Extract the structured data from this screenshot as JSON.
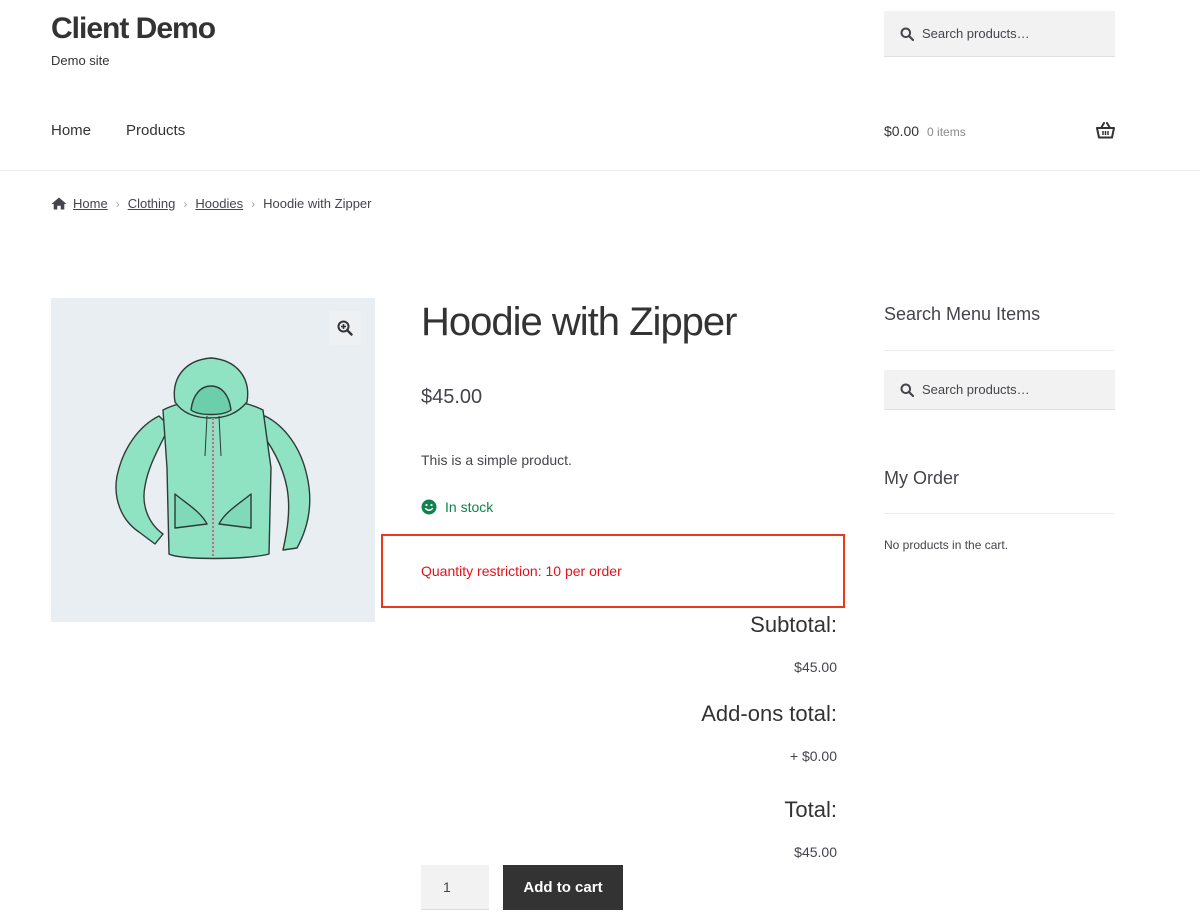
{
  "site": {
    "title": "Client Demo",
    "description": "Demo site"
  },
  "search": {
    "placeholder": "Search products…"
  },
  "nav": {
    "items": [
      "Home",
      "Products"
    ]
  },
  "cart": {
    "amount": "$0.00",
    "count": "0 items"
  },
  "breadcrumb": {
    "items": [
      "Home",
      "Clothing",
      "Hoodies",
      "Hoodie with Zipper"
    ]
  },
  "product": {
    "title": "Hoodie with Zipper",
    "price": "$45.00",
    "description": "This is a simple product.",
    "stock": "In stock",
    "restriction": "Quantity restriction: 10 per order",
    "quantity": "1",
    "add_to_cart": "Add to cart"
  },
  "totals": {
    "subtotal_label": "Subtotal:",
    "subtotal_value": "$45.00",
    "addons_label": "Add-ons total:",
    "addons_value": "+ $0.00",
    "total_label": "Total:",
    "total_value": "$45.00"
  },
  "sidebar": {
    "search_title": "Search Menu Items",
    "order_title": "My Order",
    "order_empty": "No products in the cart."
  },
  "colors": {
    "accent_stock": "#0f834d",
    "restriction": "#e2121b",
    "highlight_box": "#e8391d",
    "button": "#333333"
  }
}
